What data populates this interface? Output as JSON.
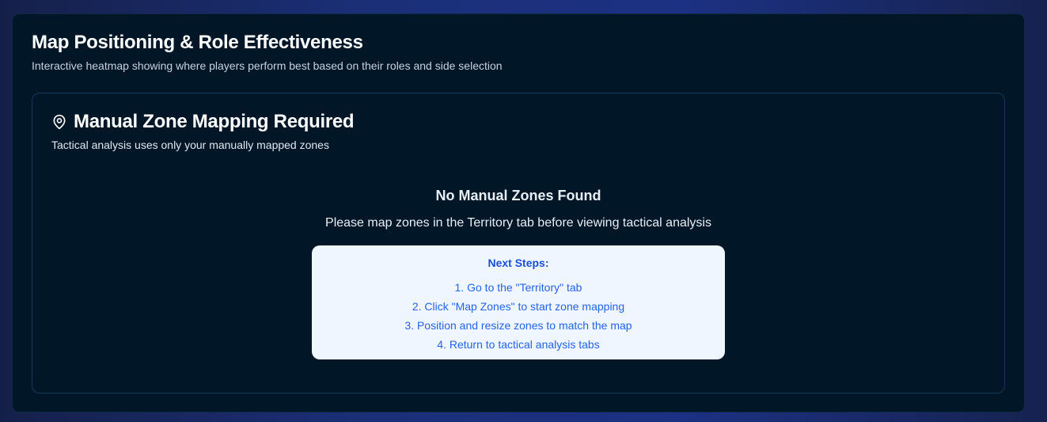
{
  "panel": {
    "title": "Map Positioning & Role Effectiveness",
    "subtitle": "Interactive heatmap showing where players perform best based on their roles and side selection"
  },
  "card": {
    "icon": "map-pin-icon",
    "title": "Manual Zone Mapping Required",
    "subtitle": "Tactical analysis uses only your manually mapped zones"
  },
  "empty_state": {
    "heading": "No Manual Zones Found",
    "message": "Please map zones in the Territory tab before viewing tactical analysis",
    "next_steps_title": "Next Steps:",
    "steps": [
      "1. Go to the \"Territory\" tab",
      "2. Click \"Map Zones\" to start zone mapping",
      "3. Position and resize zones to match the map",
      "4. Return to tactical analysis tabs"
    ]
  },
  "colors": {
    "panel_bg": "#011627",
    "steps_bg": "#eff6ff",
    "steps_text": "#2563eb"
  }
}
